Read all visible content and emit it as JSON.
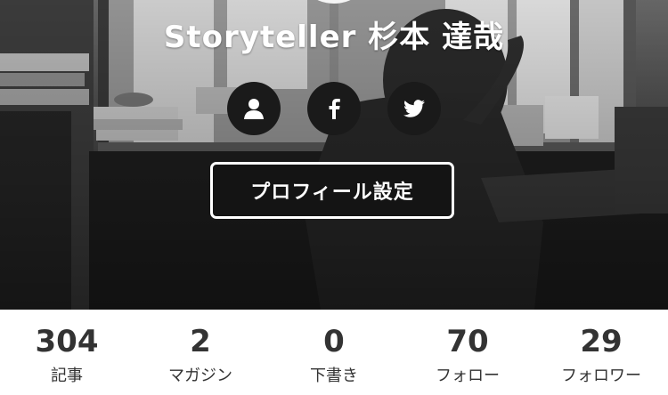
{
  "profile": {
    "title": "Storyteller 杉本 達哉",
    "settings_button": "プロフィール設定"
  },
  "social": {
    "items": [
      {
        "icon": "person-icon"
      },
      {
        "icon": "facebook-icon"
      },
      {
        "icon": "twitter-icon"
      }
    ]
  },
  "stats": [
    {
      "value": "304",
      "label": "記事"
    },
    {
      "value": "2",
      "label": "マガジン"
    },
    {
      "value": "0",
      "label": "下書き"
    },
    {
      "value": "70",
      "label": "フォロー"
    },
    {
      "value": "29",
      "label": "フォロワー"
    }
  ]
}
